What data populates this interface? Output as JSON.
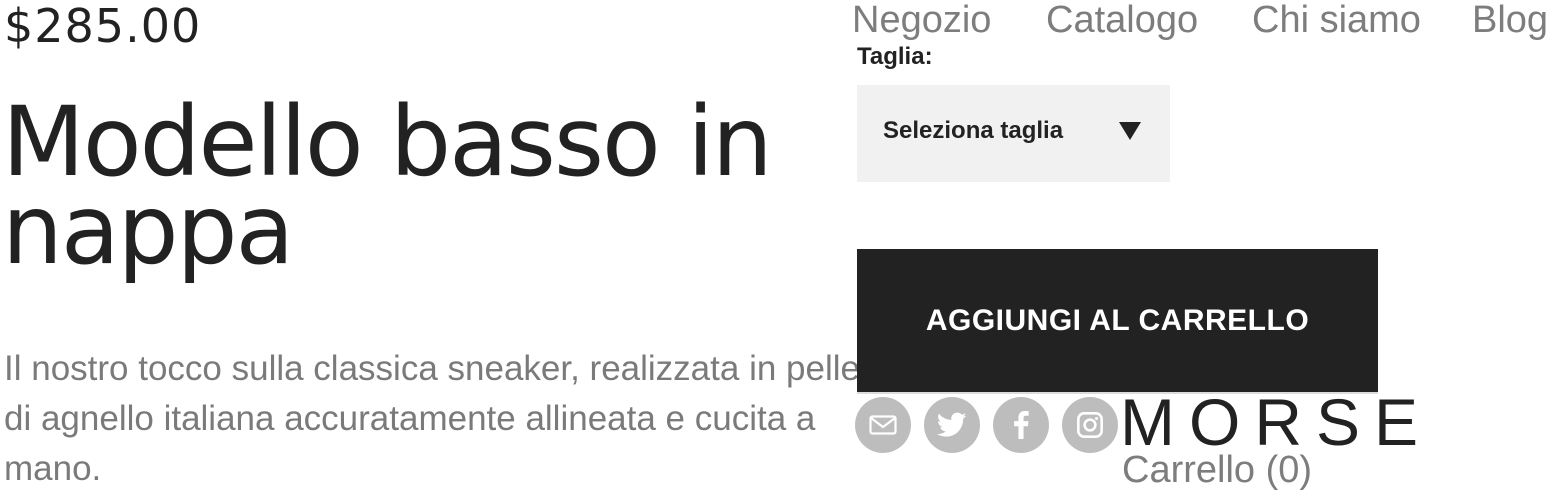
{
  "product": {
    "price": "$285.00",
    "title": "Modello basso in nappa",
    "description": "Il nostro tocco sulla classica sneaker, realizzata in pelle di agnello italiana accuratamente allineata e cucita a mano."
  },
  "nav": {
    "items": [
      {
        "label": "Negozio"
      },
      {
        "label": "Catalogo"
      },
      {
        "label": "Chi siamo"
      },
      {
        "label": "Blog"
      }
    ]
  },
  "size": {
    "label": "Taglia:",
    "selected": "Seleziona taglia"
  },
  "actions": {
    "add_to_cart": "AGGIUNGI AL CARRELLO"
  },
  "social": {
    "icons": [
      "mail-icon",
      "twitter-icon",
      "facebook-icon",
      "instagram-icon"
    ],
    "color": "#bdbdbd"
  },
  "brand": {
    "logo": "MORSE",
    "cart_link": "Carrello (0)"
  },
  "colors": {
    "button_bg": "#222222",
    "select_bg": "#f1f1f1",
    "muted_text": "#7d7d7d"
  }
}
